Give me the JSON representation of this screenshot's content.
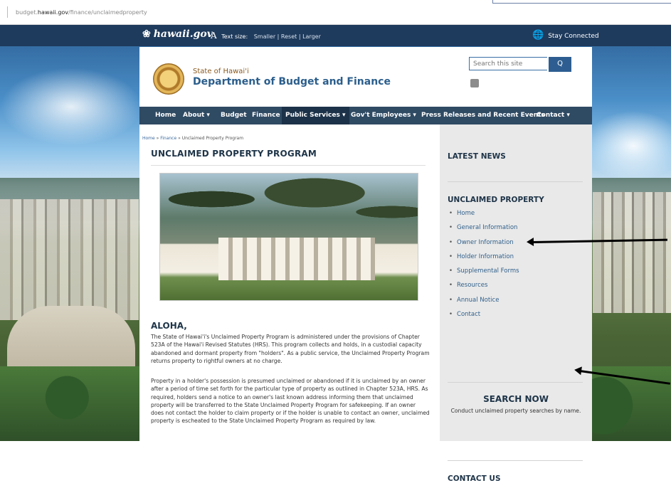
{
  "browser": {
    "url_prefix": "budget.",
    "url_domain": "hawaii.gov",
    "url_path": "/finance/unclaimedproperty"
  },
  "topbar": {
    "logo": "hawaii.gov",
    "logo_mark": "❀",
    "text_size_icon": "A",
    "text_size_label": "Text size:",
    "smaller": "Smaller",
    "sep1": " | ",
    "reset": "Reset",
    "sep2": " | ",
    "larger": "Larger",
    "stay_connected": "Stay Connected",
    "globe_icon": "🌐"
  },
  "header": {
    "state": "State of Hawai'i",
    "department": "Department of Budget and Finance",
    "search_placeholder": "Search this site",
    "search_button": "Q"
  },
  "nav": [
    {
      "label": "Home"
    },
    {
      "label": "About ▾"
    },
    {
      "label": "Budget"
    },
    {
      "label": "Finance"
    },
    {
      "label": "Public Services ▾"
    },
    {
      "label": "Gov't Employees ▾"
    },
    {
      "label": "Press Releases and Recent Events"
    },
    {
      "label": "Contact ▾"
    }
  ],
  "breadcrumb": {
    "home": "Home",
    "sep1": " » ",
    "finance": "Finance",
    "sep2": " » ",
    "current": "Unclaimed Property Program"
  },
  "page_title": "UNCLAIMED PROPERTY PROGRAM",
  "aloha": "ALOHA,",
  "paragraphs": [
    "The State of Hawai'i's Unclaimed Property Program is administered under the provisions of Chapter 523A of the Hawai'i Revised Statutes (HRS).  This program collects and holds, in a custodial capacity abandoned and dormant property from \"holders\".  As a public service, the Unclaimed Property Program returns property to rightful owners at no charge.",
    "Property in a holder's possession is presumed unclaimed or abandoned if it is unclaimed by an owner after a period of time set forth for the particular type of property as outlined in Chapter 523A, HRS.  As required, holders send a notice to an owner's last known address informing them that unclaimed property will be transferred to the State Unclaimed Property Program for safekeeping.  If an owner does not contact the holder to claim property or if the holder is unable to contact an owner, unclaimed property is escheated to the State Unclaimed Property Program as required by law."
  ],
  "sidebar": {
    "latest_news": "LATEST NEWS",
    "unclaimed_heading": "UNCLAIMED PROPERTY",
    "links": [
      "Home",
      "General Information",
      "Owner Information",
      "Holder Information",
      "Supplemental Forms",
      "Resources",
      "Annual Notice",
      "Contact"
    ],
    "search_now": "SEARCH NOW",
    "search_desc": "Conduct unclaimed property searches by name.",
    "contact_us": "CONTACT US"
  }
}
